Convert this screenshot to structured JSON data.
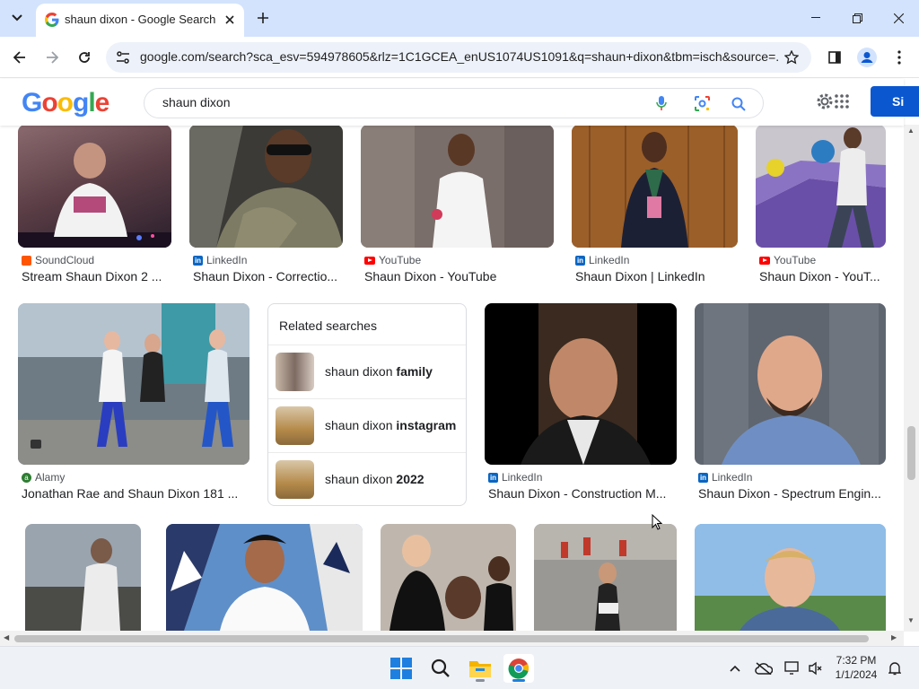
{
  "browser": {
    "tab_title": "shaun dixon - Google Search",
    "url": "google.com/search?sca_esv=594978605&rlz=1C1GCEA_enUS1074US1091&q=shaun+dixon&tbm=isch&source=..."
  },
  "google": {
    "logo_text": "Google",
    "query": "shaun dixon",
    "signin_label": "Si"
  },
  "results_row1": [
    {
      "source": "SoundCloud",
      "title": "Stream Shaun Dixon 2 ..."
    },
    {
      "source": "LinkedIn",
      "title": "Shaun Dixon - Correctio..."
    },
    {
      "source": "YouTube",
      "title": "Shaun Dixon - YouTube"
    },
    {
      "source": "LinkedIn",
      "title": "Shaun Dixon | LinkedIn"
    },
    {
      "source": "YouTube",
      "title": "Shaun Dixon - YouT..."
    }
  ],
  "results_row2": [
    {
      "source": "Alamy",
      "title": "Jonathan Rae and Shaun Dixon 181 ..."
    },
    {
      "source": "LinkedIn",
      "title": "Shaun Dixon - Construction M..."
    },
    {
      "source": "LinkedIn",
      "title": "Shaun Dixon - Spectrum Engin..."
    }
  ],
  "related": {
    "title": "Related searches",
    "items": [
      {
        "prefix": "shaun dixon ",
        "bold": "family"
      },
      {
        "prefix": "shaun dixon ",
        "bold": "instagram"
      },
      {
        "prefix": "shaun dixon ",
        "bold": "2022"
      }
    ]
  },
  "taskbar": {
    "time": "7:32 PM",
    "date": "1/1/2024"
  },
  "colors": {
    "tabstrip": "#d3e3fd",
    "omnibox": "#edf2fa",
    "signin": "#0b57d0",
    "taskbar": "#eef1f6"
  }
}
